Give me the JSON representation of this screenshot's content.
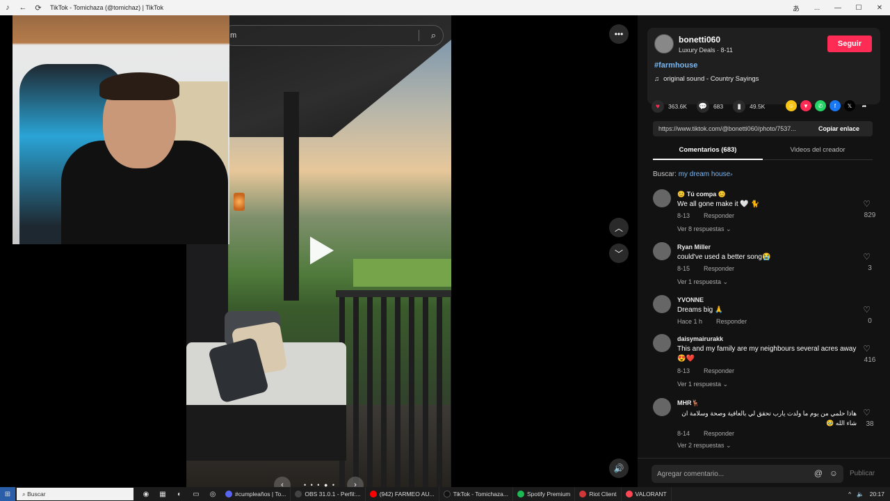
{
  "window": {
    "title": "TikTok - Tomichaza (@tomichaz) | TikTok",
    "translate_icon": "translate-icon",
    "controls": [
      "...",
      "—",
      "☐",
      "✕"
    ]
  },
  "player": {
    "search_text": "m",
    "more_icon": "•••",
    "pager_dots": "• • • ● •",
    "prev_label": "‹",
    "next_label": "›",
    "up_label": "︿",
    "down_label": "﹀",
    "volume_icon": "volume-icon"
  },
  "creator": {
    "username": "bonetti060",
    "subtitle": "Luxury Deals · 8-11",
    "follow_label": "Seguir",
    "hashtag": "#farmhouse",
    "music": "original sound - Country Sayings"
  },
  "stats": {
    "likes": "363.6K",
    "comments": "683",
    "saves": "49.5K"
  },
  "share_colors": [
    "#f5c518",
    "#fe2c55",
    "#25d366",
    "#1877f2",
    "#000000"
  ],
  "link": {
    "url": "https://www.tiktok.com/@bonetti060/photo/7537...",
    "copy_label": "Copiar enlace"
  },
  "tabs": {
    "comments": "Comentarios (683)",
    "videos": "Videos del creador"
  },
  "search_term": {
    "prefix": "Buscar:",
    "term": "my dream house"
  },
  "comments": [
    {
      "name": "😊 Tú compa 😊",
      "text": "We all gone make it 🤍 🐈",
      "date": "8-13",
      "reply": "Responder",
      "more": "Ver 8 respuestas ⌄",
      "likes": "829"
    },
    {
      "name": "Ryan Miller",
      "text": "could've used a better song😭",
      "date": "8-15",
      "reply": "Responder",
      "more": "Ver 1 respuesta ⌄",
      "likes": "3"
    },
    {
      "name": "YVONNE",
      "text": "Dreams big 🙏",
      "date": "Hace 1 h",
      "reply": "Responder",
      "more": "",
      "likes": "0"
    },
    {
      "name": "daisymairurakk",
      "text": "This and my family are my neighbours several acres away 😍❤️",
      "date": "8-13",
      "reply": "Responder",
      "more": "Ver 1 respuesta ⌄",
      "likes": "416"
    },
    {
      "name": "MHR🦌",
      "text": "هاذا حلمي من يوم ما ولدت يارب تحقق لي بالعافية وصحة وسلامة ان شاء الله 🥹",
      "date": "8-14",
      "reply": "Responder",
      "more": "Ver 2 respuestas ⌄",
      "likes": "38"
    }
  ],
  "add_comment": {
    "placeholder": "Agregar comentario...",
    "post_label": "Publicar"
  },
  "taskbar": {
    "search": "Buscar",
    "apps": [
      {
        "label": "#cumpleaños | To...",
        "color": "#5865f2"
      },
      {
        "label": "OBS 31.0.1 - Perfil:...",
        "color": "#444444"
      },
      {
        "label": "(942) FARMEO AU...",
        "color": "#ff0000"
      },
      {
        "label": "TikTok - Tomichaza...",
        "color": "#111111"
      },
      {
        "label": "Spotify Premium",
        "color": "#1db954"
      },
      {
        "label": "Riot Client",
        "color": "#d13639"
      },
      {
        "label": "VALORANT",
        "color": "#ff4655"
      }
    ],
    "time": "20:17"
  }
}
